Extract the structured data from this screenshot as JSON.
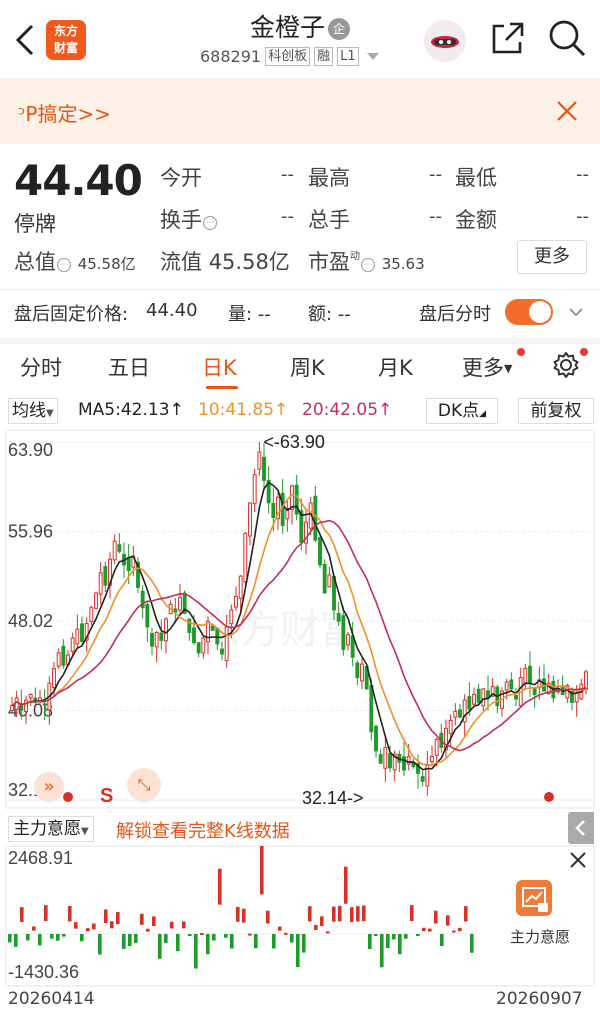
{
  "header": {
    "stock_name": "金橙子",
    "badge": "企",
    "code": "688291",
    "tags": [
      "科创板",
      "融",
      "L1"
    ],
    "logo_text": [
      "东方",
      "财富"
    ]
  },
  "banner": {
    "text": "ᵓP搞定>>"
  },
  "quote": {
    "price": "44.40",
    "status": "停牌",
    "fields": [
      {
        "label": "今开",
        "value": "--"
      },
      {
        "label": "最高",
        "value": "--"
      },
      {
        "label": "最低",
        "value": "--"
      },
      {
        "label": "换手",
        "value": "--"
      },
      {
        "label": "总手",
        "value": "--"
      },
      {
        "label": "金额",
        "value": "--"
      }
    ],
    "total_value_label": "总值",
    "total_value": "45.58亿",
    "float_value_label": "流值",
    "float_value": "45.58亿",
    "pe_label": "市盈",
    "pe_sup": "动",
    "pe_value": "35.63",
    "more": "更多"
  },
  "after_hours": {
    "fixed_price_label": "盘后固定价格:",
    "fixed_price": "44.40",
    "volume": "量: --",
    "amount": "额: --",
    "timeshare": "盘后分时"
  },
  "tabs": [
    "分时",
    "五日",
    "日K",
    "周K",
    "月K",
    "更多"
  ],
  "active_tab": "日K",
  "ma_row": {
    "selector": "均线",
    "ma5": "MA5:42.13↑",
    "ma10": "10:41.85↑",
    "ma20": "20:42.05↑",
    "dk": "DK点",
    "adjust": "前复权"
  },
  "colors": {
    "up": "#d93026",
    "down": "#1f9b2b",
    "ma5": "#222222",
    "ma10": "#f0902c",
    "ma20": "#c02e5c",
    "accent": "#e65514"
  },
  "chart_data": {
    "type": "candlestick",
    "y_ticks": [
      "63.90",
      "55.96",
      "48.02",
      "40.08",
      "32.14"
    ],
    "ylim": [
      32.14,
      63.9
    ],
    "high_label": "<-63.90",
    "low_label": "32.14->",
    "markers": [
      "S"
    ],
    "closes": [
      40.5,
      41.2,
      40.1,
      41.0,
      41.5,
      40.8,
      41.2,
      40.6,
      42.5,
      43.8,
      45.2,
      44.1,
      45.0,
      46.5,
      47.3,
      46.2,
      47.8,
      49.2,
      50.5,
      52.3,
      51.2,
      53.5,
      55.1,
      54.2,
      53.0,
      52.5,
      53.8,
      51.0,
      49.2,
      47.5,
      45.8,
      47.0,
      46.3,
      48.2,
      49.5,
      48.8,
      50.1,
      48.7,
      47.0,
      46.1,
      45.2,
      46.5,
      48.0,
      47.2,
      46.0,
      45.1,
      47.5,
      49.0,
      50.2,
      52.0,
      55.8,
      58.5,
      61.0,
      63.0,
      60.5,
      58.5,
      57.2,
      59.0,
      56.5,
      58.0,
      60.0,
      57.5,
      55.0,
      56.8,
      58.5,
      55.2,
      53.0,
      50.5,
      52.1,
      49.0,
      48.0,
      45.5,
      46.8,
      44.8,
      43.0,
      44.2,
      42.0,
      38.2,
      36.5,
      35.4,
      36.8,
      35.0,
      36.2,
      35.5,
      34.8,
      36.0,
      35.1,
      34.5,
      33.8,
      35.2,
      36.0,
      37.5,
      36.8,
      38.5,
      39.2,
      40.0,
      39.5,
      41.0,
      40.2,
      41.5,
      40.8,
      42.0,
      41.2,
      42.2,
      40.5,
      41.8,
      42.6,
      42.0,
      41.1,
      43.0,
      43.8,
      42.5,
      41.5,
      42.8,
      41.8,
      42.5,
      41.2,
      42.0,
      41.5,
      42.3,
      40.8,
      41.6,
      42.4,
      43.5
    ],
    "main_force": {
      "ticks": [
        "2468.91",
        "-1430.36"
      ]
    },
    "date_start": "20260414",
    "date_end": "20260907"
  },
  "indicator": {
    "selector": "主力意愿",
    "unlock": "解锁查看完整K线数据",
    "promo_label": "主力意愿"
  }
}
